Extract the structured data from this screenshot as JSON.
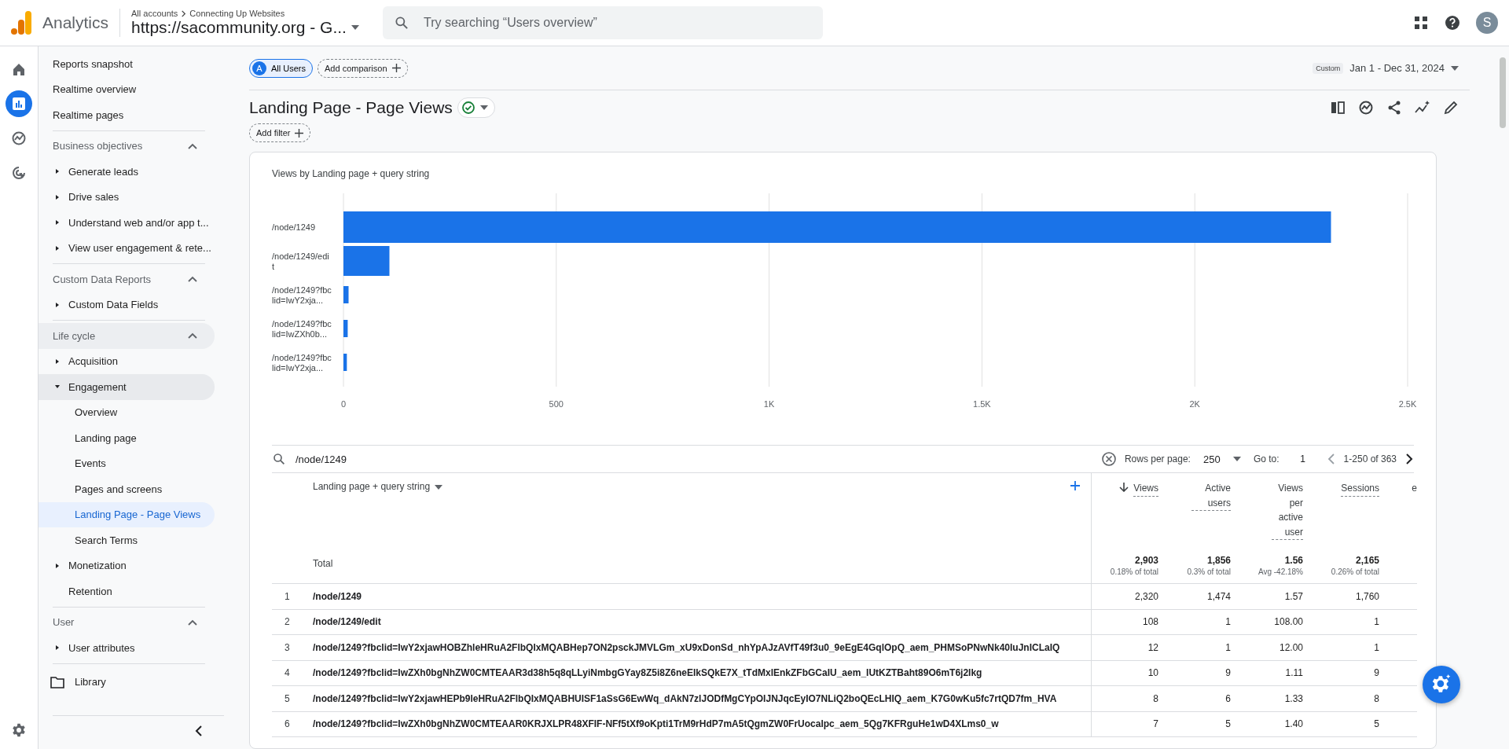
{
  "header": {
    "product": "Analytics",
    "breadcrumb": [
      "All accounts",
      "Connecting Up Websites"
    ],
    "property": "https://sacommunity.org - G...",
    "search": {
      "placeholder": "Try searching “Users overview”"
    },
    "avatar": "S"
  },
  "rail": [
    {
      "selected": false
    },
    {
      "selected": true
    },
    {
      "selected": false
    },
    {
      "selected": false
    }
  ],
  "sidebar": {
    "top_items": [
      {
        "label": "Reports snapshot",
        "selected": false
      },
      {
        "label": "Realtime overview",
        "selected": false
      },
      {
        "label": "Realtime pages",
        "selected": false
      }
    ],
    "sections": [
      {
        "title": "Business objectives",
        "expanded": true,
        "items": [
          {
            "label": "Generate leads",
            "kind": "group",
            "expanded": false
          },
          {
            "label": "Drive sales",
            "kind": "group",
            "expanded": false
          },
          {
            "label": "Understand web and/or app t...",
            "kind": "group",
            "expanded": false
          },
          {
            "label": "View user engagement & rete...",
            "kind": "group",
            "expanded": false
          }
        ]
      },
      {
        "title": "Custom Data Reports",
        "expanded": true,
        "items": [
          {
            "label": "Custom Data Fields",
            "kind": "group",
            "expanded": false
          }
        ]
      },
      {
        "title": "Life cycle",
        "expanded": true,
        "items": [
          {
            "label": "Acquisition",
            "kind": "group",
            "expanded": false
          },
          {
            "label": "Engagement",
            "kind": "group",
            "expanded": true,
            "children": [
              {
                "label": "Overview",
                "selected": false
              },
              {
                "label": "Landing page",
                "selected": false
              },
              {
                "label": "Events",
                "selected": false
              },
              {
                "label": "Pages and screens",
                "selected": false
              },
              {
                "label": "Landing Page - Page Views",
                "selected": true
              },
              {
                "label": "Search Terms",
                "selected": false
              }
            ]
          },
          {
            "label": "Monetization",
            "kind": "group",
            "expanded": false
          },
          {
            "label": "Retention",
            "kind": "link"
          }
        ]
      },
      {
        "title": "User",
        "expanded": true,
        "items": [
          {
            "label": "User attributes",
            "kind": "group",
            "expanded": false
          }
        ]
      }
    ],
    "library": "Library"
  },
  "toolbar": {
    "segments": [
      {
        "badge": "A",
        "label": "All Users",
        "selected": true
      }
    ],
    "add_comparison": "Add comparison",
    "date_badge": "Custom",
    "date_range": "Jan 1 - Dec 31, 2024"
  },
  "report": {
    "title": "Landing Page - Page Views",
    "add_filter": "Add filter",
    "chart": {
      "title": "Views by Landing page + query string",
      "chart_data": {
        "type": "bar",
        "orientation": "horizontal",
        "grid": true,
        "categories": [
          "/node/1249",
          "/node/1249/edit",
          "/node/1249?fbclid=IwY2xja...",
          "/node/1249?fbclid=IwZXh0b...",
          "/node/1249?fbclid=IwY2xja..."
        ],
        "values": [
          2320,
          108,
          12,
          10,
          8
        ],
        "xlim": [
          0,
          2500
        ],
        "xticks": [
          0,
          500,
          {
            "value": 1000,
            "label": "1K"
          },
          {
            "value": 1500,
            "label": "1.5K"
          },
          {
            "value": 2000,
            "label": "2K"
          },
          {
            "value": 2500,
            "label": "2.5K"
          }
        ]
      }
    },
    "table": {
      "search": "/node/1249",
      "rows_per_page_label": "Rows per page:",
      "rows_per_page": "250",
      "goto_label": "Go to:",
      "goto": "1",
      "range": "1-250 of 363",
      "dimension": "Landing page + query string",
      "columns": [
        {
          "label": "Views",
          "sorted": true
        },
        {
          "label": "Active users",
          "sorted": false
        },
        {
          "label": "Views per active user",
          "sorted": false
        },
        {
          "label": "Sessions",
          "sorted": false
        },
        {
          "label": "e",
          "sorted": false
        }
      ],
      "total_label": "Total",
      "totals": [
        {
          "value": "2,903",
          "sub": "0.18% of total"
        },
        {
          "value": "1,856",
          "sub": "0.3% of total"
        },
        {
          "value": "1.56",
          "sub": "Avg -42.18%"
        },
        {
          "value": "2,165",
          "sub": "0.26% of total"
        }
      ],
      "rows": [
        {
          "index": "1",
          "page": "/node/1249",
          "values": [
            "2,320",
            "1,474",
            "1.57",
            "1,760"
          ]
        },
        {
          "index": "2",
          "page": "/node/1249/edit",
          "values": [
            "108",
            "1",
            "108.00",
            "1"
          ]
        },
        {
          "index": "3",
          "page": "/node/1249?fbclid=IwY2xjawHOBZhleHRuA2FlbQIxMQABHep7ON2psckJMVLGm_xU9xDonSd_nhYpAJzAVfT49f3u0_9eEgE4GqlOpQ_aem_PHMSoPNwNk40IuJnICLaIQ",
          "values": [
            "12",
            "1",
            "12.00",
            "1"
          ]
        },
        {
          "index": "4",
          "page": "/node/1249?fbclid=IwZXh0bgNhZW0CMTEAAR3d38h5q8qLLyiNmbgGYay8Z5i8Z6neEIkSQkE7X_tTdMxlEnkZFbGCaIU_aem_IUtKZTBaht89O6mT6j2Ikg",
          "values": [
            "10",
            "9",
            "1.11",
            "9"
          ]
        },
        {
          "index": "5",
          "page": "/node/1249?fbclid=IwY2xjawHEPb9leHRuA2FlbQIxMQABHUISF1aSsG6EwWq_dAkN7zlJODfMgCYpOIJNJqcEyIO7NLiQ2boQEcLHIQ_aem_K7G0wKu5fc7rtQD7fm_HVA",
          "values": [
            "8",
            "6",
            "1.33",
            "8"
          ]
        },
        {
          "index": "6",
          "page": "/node/1249?fbclid=IwZXh0bgNhZW0CMTEAAR0KRJXLPR48XFIF-NFf5tXf9oKpti1TrM9rHdP7mA5tQgmZW0FrUocalpc_aem_5Qg7KFRguHe1wD4XLms0_w",
          "values": [
            "7",
            "5",
            "1.40",
            "5"
          ]
        }
      ]
    }
  }
}
